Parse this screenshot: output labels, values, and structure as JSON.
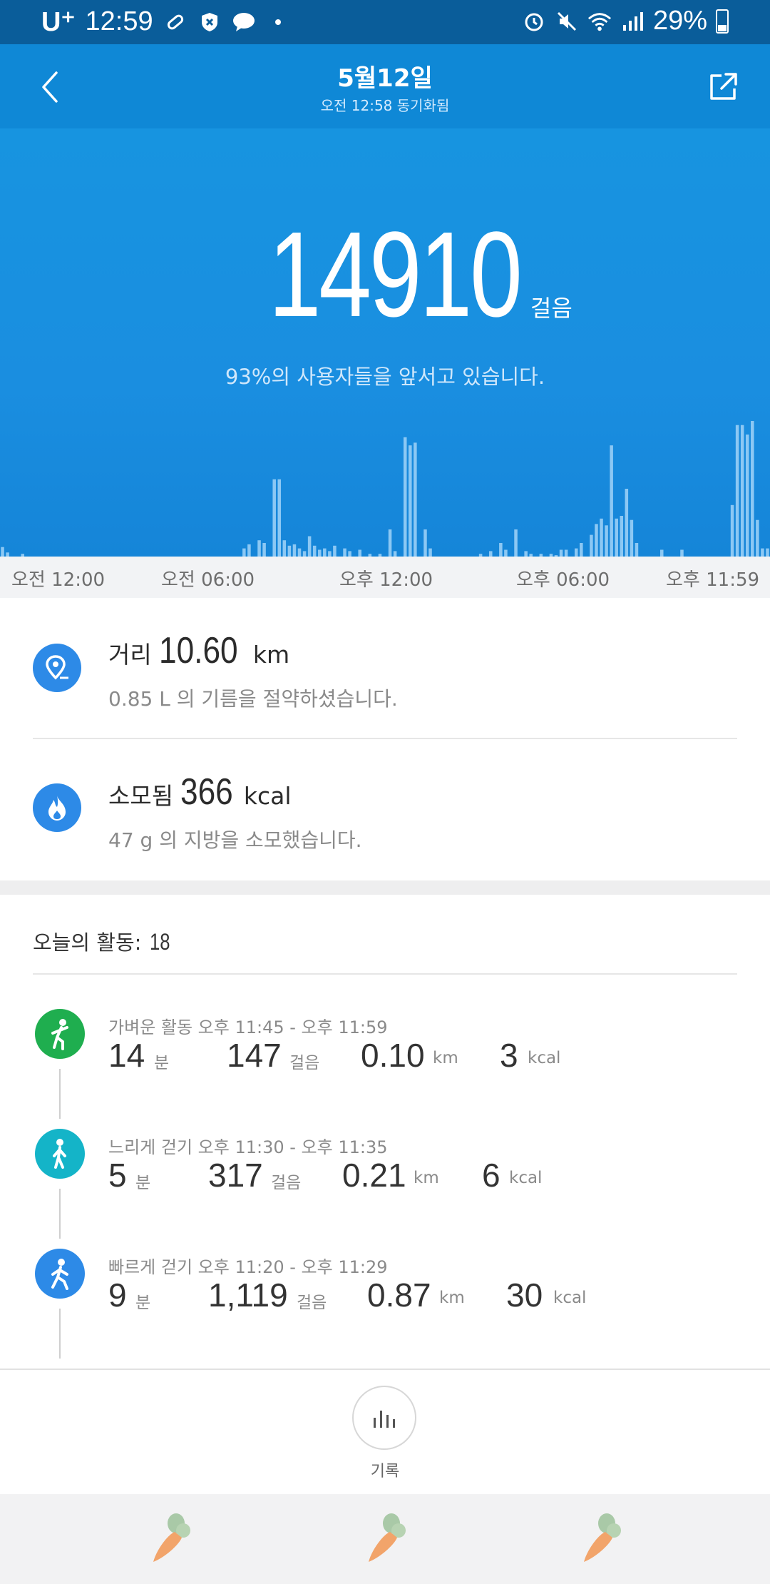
{
  "status_bar": {
    "carrier": "U⁺",
    "time": "12:59",
    "battery": "29%"
  },
  "header": {
    "title": "5월12일",
    "subtitle": "오전 12:58 동기화됨"
  },
  "summary": {
    "steps": "14910",
    "steps_unit": "걸음",
    "rank_text": "93%의 사용자들을 앞서고 있습니다."
  },
  "chart_data": {
    "type": "bar",
    "x_tick_labels": [
      "오전 12:00",
      "오전 06:00",
      "오후 12:00",
      "오후 06:00",
      "오후 11:59"
    ],
    "bins": 144,
    "values_relative": [
      0.07,
      0.03,
      0,
      0,
      0.02,
      0,
      0,
      0,
      0,
      0,
      0,
      0,
      0,
      0,
      0,
      0,
      0,
      0,
      0,
      0,
      0,
      0,
      0,
      0,
      0,
      0,
      0,
      0,
      0,
      0,
      0,
      0,
      0,
      0,
      0,
      0,
      0,
      0,
      0,
      0,
      0,
      0,
      0,
      0,
      0,
      0,
      0,
      0,
      0.06,
      0.09,
      0,
      0.12,
      0.1,
      0,
      0.57,
      0.57,
      0.12,
      0.08,
      0.09,
      0.06,
      0.04,
      0.15,
      0.08,
      0.05,
      0.06,
      0.04,
      0.08,
      0,
      0.06,
      0.04,
      0,
      0.05,
      0,
      0.02,
      0,
      0.02,
      0,
      0.2,
      0.04,
      0,
      0.88,
      0.82,
      0.84,
      0,
      0.2,
      0.06,
      0,
      0,
      0,
      0,
      0,
      0,
      0,
      0,
      0,
      0.02,
      0,
      0.04,
      0,
      0.1,
      0.05,
      0,
      0.2,
      0,
      0.04,
      0.02,
      0,
      0.02,
      0,
      0.02,
      0.01,
      0.05,
      0.05,
      0,
      0.06,
      0.1,
      0,
      0.16,
      0.24,
      0.28,
      0.23,
      0.82,
      0.28,
      0.3,
      0.5,
      0.27,
      0.1,
      0,
      0,
      0,
      0,
      0.05,
      0,
      0,
      0,
      0.05,
      0,
      0,
      0,
      0,
      0,
      0,
      0,
      0,
      0,
      0.38,
      0.97,
      0.97,
      0.9,
      1,
      0.27,
      0.06,
      0.06
    ],
    "bar_color": "#8cc8f4"
  },
  "metrics": {
    "distance": {
      "label": "거리",
      "value": "10.60",
      "unit": "km",
      "sub": "0.85 L 의 기름을 절약하셨습니다.",
      "icon": "location-pin-icon"
    },
    "calories": {
      "label": "소모됨",
      "value": "366",
      "unit": "kcal",
      "sub": "47 g 의 지방을 소모했습니다.",
      "icon": "flame-icon"
    }
  },
  "activities": {
    "title": "오늘의 활동:",
    "count": "18",
    "items": [
      {
        "label": "가벼운 활동 오후 11:45 - 오후 11:59",
        "minutes": "14",
        "minutes_unit": "분",
        "steps": "147",
        "steps_unit": "걸음",
        "distance": "0.10",
        "distance_unit": "km",
        "kcal": "3",
        "kcal_unit": "kcal",
        "icon_color": "#1fae4f"
      },
      {
        "label": "느리게 걷기 오후 11:30 - 오후 11:35",
        "minutes": "5",
        "minutes_unit": "분",
        "steps": "317",
        "steps_unit": "걸음",
        "distance": "0.21",
        "distance_unit": "km",
        "kcal": "6",
        "kcal_unit": "kcal",
        "icon_color": "#14b4c8"
      },
      {
        "label": "빠르게 걷기 오후 11:20 - 오후 11:29",
        "minutes": "9",
        "minutes_unit": "분",
        "steps": "1,119",
        "steps_unit": "걸음",
        "distance": "0.87",
        "distance_unit": "km",
        "kcal": "30",
        "kcal_unit": "kcal",
        "icon_color": "#2d8ae7"
      }
    ]
  },
  "history": {
    "label": "기록"
  },
  "colors": {
    "header": "#0f88d6",
    "accent": "#2d8ae7"
  }
}
